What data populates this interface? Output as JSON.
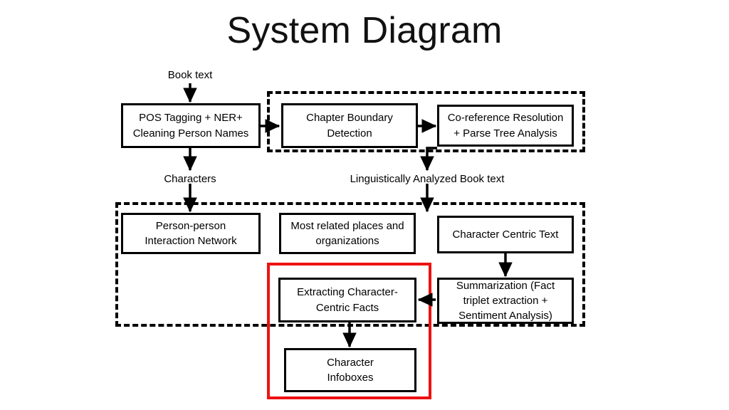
{
  "page": {
    "title": "System Diagram",
    "background_color": "#ffffff",
    "stroke_color": "#000000",
    "highlight_color": "#ee1111"
  },
  "captions": {
    "book_text": "Book text",
    "characters": "Characters",
    "linguistic": "Linguistically Analyzed Book text"
  },
  "nodes": {
    "pos_tagging": {
      "line1": "POS Tagging + NER+",
      "line2": "Cleaning Person Names"
    },
    "chapter_boundary": {
      "line1": "Chapter Boundary",
      "line2": "Detection"
    },
    "coreference": {
      "line1": "Co-reference Resolution",
      "line2": "+ Parse Tree Analysis"
    },
    "person_network": {
      "line1": "Person-person",
      "line2": "Interaction Network"
    },
    "places_orgs": {
      "line1": "Most related places and",
      "line2": "organizations"
    },
    "character_text": {
      "line1": "Character Centric Text"
    },
    "extracting_facts": {
      "line1": "Extracting Character-",
      "line2": "Centric Facts"
    },
    "summarization": {
      "line1": "Summarization (Fact",
      "line2": "triplet extraction +",
      "line3": "Sentiment Analysis)"
    },
    "infoboxes": {
      "line1": "Character",
      "line2": "Infoboxes"
    }
  },
  "chart_data": {
    "type": "diagram",
    "title": "System Diagram",
    "nodes": [
      {
        "id": "pos_tagging",
        "label": "POS Tagging + NER+ Cleaning Person Names",
        "group": null
      },
      {
        "id": "chapter_boundary",
        "label": "Chapter Boundary Detection",
        "group": "preprocessing"
      },
      {
        "id": "coreference",
        "label": "Co-reference Resolution + Parse Tree Analysis",
        "group": "preprocessing"
      },
      {
        "id": "person_network",
        "label": "Person-person Interaction Network",
        "group": "analysis"
      },
      {
        "id": "places_orgs",
        "label": "Most related places and organizations",
        "group": "analysis"
      },
      {
        "id": "character_text",
        "label": "Character Centric Text",
        "group": "analysis"
      },
      {
        "id": "extracting_facts",
        "label": "Extracting Character-Centric Facts",
        "group": "analysis",
        "highlighted": true
      },
      {
        "id": "summarization",
        "label": "Summarization (Fact triplet extraction + Sentiment Analysis)",
        "group": "analysis"
      },
      {
        "id": "infoboxes",
        "label": "Character Infoboxes",
        "group": null,
        "highlighted": true
      }
    ],
    "edges": [
      {
        "from": "book_text_input",
        "to": "pos_tagging",
        "label": "Book text"
      },
      {
        "from": "pos_tagging",
        "to": "chapter_boundary",
        "label": ""
      },
      {
        "from": "chapter_boundary",
        "to": "coreference",
        "label": ""
      },
      {
        "from": "pos_tagging",
        "to": "person_network",
        "label": "Characters"
      },
      {
        "from": "coreference",
        "to": "places_orgs",
        "label": "Linguistically Analyzed Book text"
      },
      {
        "from": "character_text",
        "to": "summarization",
        "label": ""
      },
      {
        "from": "summarization",
        "to": "extracting_facts",
        "label": ""
      },
      {
        "from": "extracting_facts",
        "to": "infoboxes",
        "label": ""
      }
    ],
    "groups": [
      {
        "id": "preprocessing",
        "style": "dashed"
      },
      {
        "id": "analysis",
        "style": "dashed"
      },
      {
        "id": "highlight",
        "style": "solid-red",
        "members": [
          "extracting_facts",
          "infoboxes"
        ]
      }
    ]
  }
}
